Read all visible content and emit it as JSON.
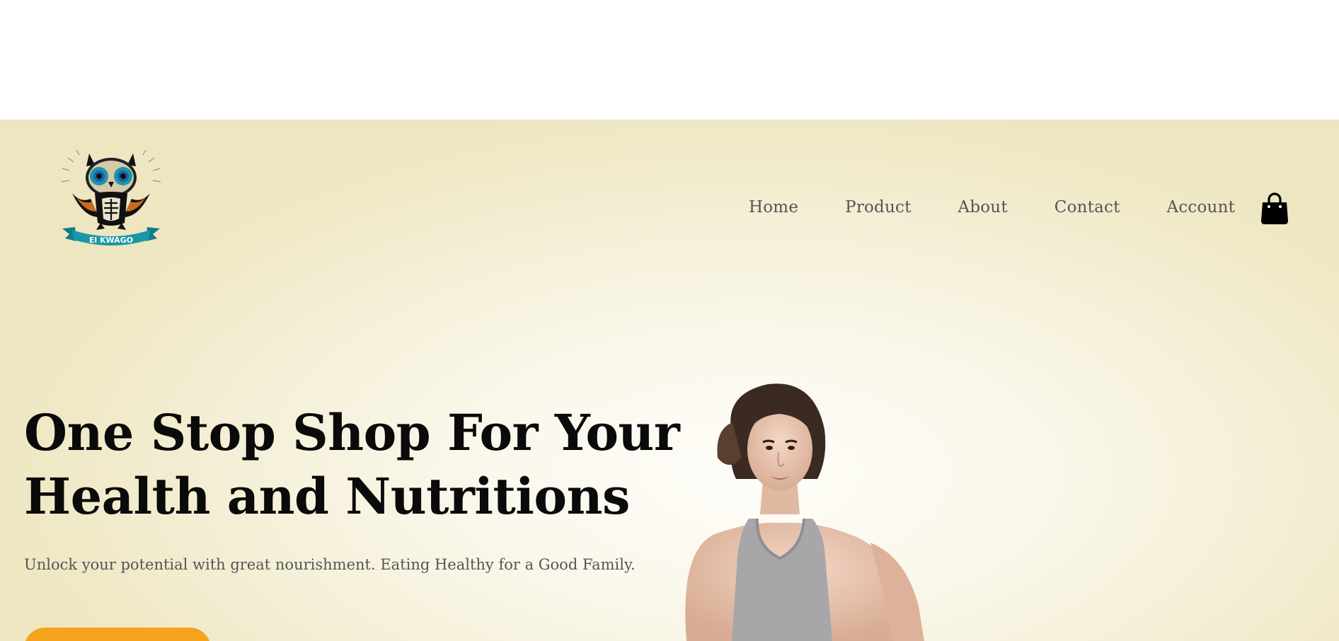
{
  "brand": {
    "logo_text": "El KWAGO"
  },
  "nav": {
    "items": [
      {
        "label": "Home"
      },
      {
        "label": "Product"
      },
      {
        "label": "About"
      },
      {
        "label": "Contact"
      },
      {
        "label": "Account"
      }
    ],
    "cart_icon": "shopping-bag-icon"
  },
  "hero": {
    "headline": "One Stop Shop For Your Health and Nutritions",
    "subtext": "Unlock your potential with great nourishment. Eating Healthy for a Good Family.",
    "cta_label": ""
  },
  "colors": {
    "accent": "#f5a31c",
    "hero_bg": "#f3eed3",
    "text_dark": "#0a0a0a",
    "text_muted": "#555555",
    "logo_teal": "#1a97a6"
  }
}
